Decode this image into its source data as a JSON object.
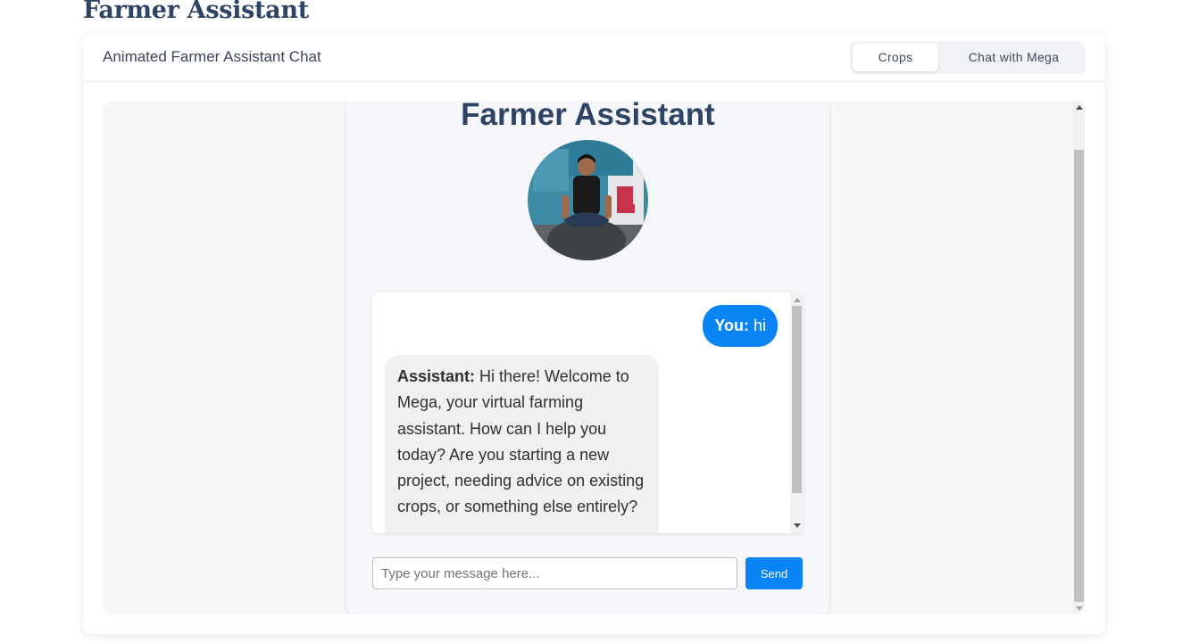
{
  "page": {
    "title": "Farmer Assistant"
  },
  "card": {
    "title": "Animated Farmer Assistant Chat"
  },
  "tabs": [
    {
      "label": "Crops",
      "active": true
    },
    {
      "label": "Chat with Mega",
      "active": false
    }
  ],
  "app": {
    "title": "Farmer Assistant",
    "avatar": "photo of person sitting cross-legged"
  },
  "chat": {
    "messages": [
      {
        "sender": "You:",
        "text": " hi"
      },
      {
        "sender": "Assistant:",
        "text": " Hi there! Welcome to Mega, your virtual farming assistant. How can I help you today? Are you starting a new project, needing advice on existing crops, or something else entirely?"
      }
    ],
    "input_placeholder": "Type your message here...",
    "input_value": "",
    "send_label": "Send"
  },
  "colors": {
    "accent": "#0a84f5",
    "title": "#2f4464",
    "assistant_bubble": "#f0f0f0"
  }
}
